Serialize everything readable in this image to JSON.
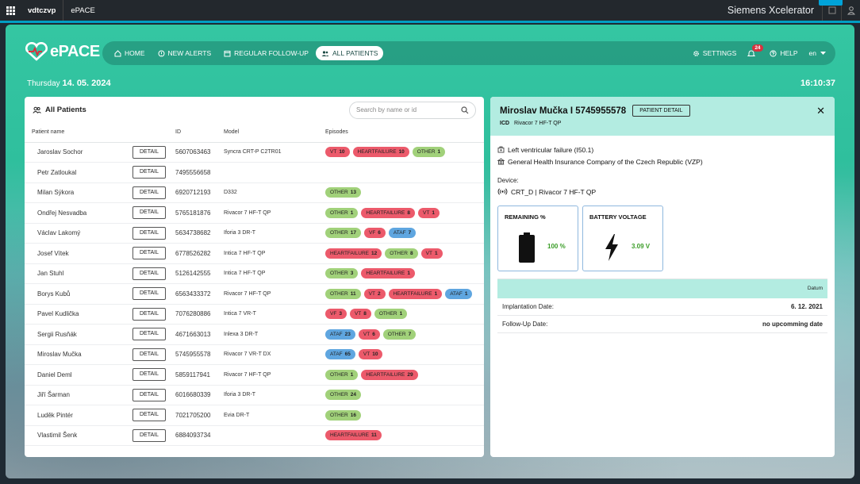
{
  "topbar": {
    "org": "vdtczvp",
    "app": "ePACE",
    "brand": "Siemens Xcelerator"
  },
  "header": {
    "logo_text": "ePACE",
    "nav": [
      {
        "label": "HOME",
        "icon": "home-icon"
      },
      {
        "label": "NEW ALERTS",
        "icon": "alert-icon"
      },
      {
        "label": "REGULAR FOLLOW-UP",
        "icon": "calendar-icon"
      },
      {
        "label": "ALL PATIENTS",
        "icon": "users-icon",
        "active": true
      }
    ],
    "settings_label": "SETTINGS",
    "notifications_count": "24",
    "help_label": "HELP",
    "language": "en"
  },
  "datebar": {
    "weekday": "Thursday",
    "date": "14. 05. 2024",
    "time": "16:10:37"
  },
  "patients_panel": {
    "title": "All Patients",
    "search_placeholder": "Search by name or id",
    "columns": [
      "Patient name",
      "ID",
      "Model",
      "Episodes"
    ],
    "detail_label": "DETAIL",
    "rows": [
      {
        "name": "Jaroslav Sochor",
        "id": "5607063463",
        "model": "Syncra CRT-P C2TR01",
        "episodes": [
          {
            "t": "VT",
            "n": "10",
            "c": "red"
          },
          {
            "t": "HEARTFAILURE",
            "n": "10",
            "c": "red"
          },
          {
            "t": "OTHER",
            "n": "1",
            "c": "green"
          }
        ]
      },
      {
        "name": "Petr Zatloukal",
        "id": "7495556658",
        "model": "",
        "episodes": []
      },
      {
        "name": "Milan Sýkora",
        "id": "6920712193",
        "model": "D332",
        "episodes": [
          {
            "t": "OTHER",
            "n": "13",
            "c": "green"
          }
        ]
      },
      {
        "name": "Ondřej Nesvadba",
        "id": "5765181876",
        "model": "Rivacor 7 HF-T QP",
        "episodes": [
          {
            "t": "OTHER",
            "n": "1",
            "c": "green"
          },
          {
            "t": "HEARTFAILURE",
            "n": "8",
            "c": "red"
          },
          {
            "t": "VT",
            "n": "1",
            "c": "red"
          }
        ]
      },
      {
        "name": "Václav Lakomý",
        "id": "5634738682",
        "model": "Iforia 3 DR-T",
        "episodes": [
          {
            "t": "OTHER",
            "n": "17",
            "c": "green"
          },
          {
            "t": "VF",
            "n": "6",
            "c": "red"
          },
          {
            "t": "ATAF",
            "n": "7",
            "c": "blue"
          }
        ]
      },
      {
        "name": "Josef Vítek",
        "id": "6778526282",
        "model": "Intica 7 HF-T QP",
        "episodes": [
          {
            "t": "HEARTFAILURE",
            "n": "12",
            "c": "red"
          },
          {
            "t": "OTHER",
            "n": "8",
            "c": "green"
          },
          {
            "t": "VT",
            "n": "1",
            "c": "red"
          }
        ]
      },
      {
        "name": "Jan Stuhl",
        "id": "5126142555",
        "model": "Intica 7 HF-T QP",
        "episodes": [
          {
            "t": "OTHER",
            "n": "3",
            "c": "green"
          },
          {
            "t": "HEARTFAILURE",
            "n": "1",
            "c": "red"
          }
        ]
      },
      {
        "name": "Borys Kubů",
        "id": "6563433372",
        "model": "Rivacor 7 HF-T QP",
        "episodes": [
          {
            "t": "OTHER",
            "n": "11",
            "c": "green"
          },
          {
            "t": "VT",
            "n": "2",
            "c": "red"
          },
          {
            "t": "HEARTFAILURE",
            "n": "1",
            "c": "red"
          },
          {
            "t": "ATAF",
            "n": "1",
            "c": "blue"
          }
        ]
      },
      {
        "name": "Pavel Kudlička",
        "id": "7076280886",
        "model": "Intica 7 VR-T",
        "episodes": [
          {
            "t": "VF",
            "n": "3",
            "c": "red"
          },
          {
            "t": "VT",
            "n": "8",
            "c": "red"
          },
          {
            "t": "OTHER",
            "n": "1",
            "c": "green"
          }
        ]
      },
      {
        "name": "Sergii Rusňák",
        "id": "4671663013",
        "model": "Inlexa 3 DR-T",
        "episodes": [
          {
            "t": "ATAF",
            "n": "23",
            "c": "blue"
          },
          {
            "t": "VT",
            "n": "6",
            "c": "red"
          },
          {
            "t": "OTHER",
            "n": "7",
            "c": "green"
          }
        ]
      },
      {
        "name": "Miroslav Mučka",
        "id": "5745955578",
        "model": "Rivacor 7 VR-T DX",
        "episodes": [
          {
            "t": "ATAF",
            "n": "65",
            "c": "blue"
          },
          {
            "t": "VT",
            "n": "10",
            "c": "red"
          }
        ]
      },
      {
        "name": "Daniel Deml",
        "id": "5859117941",
        "model": "Rivacor 7 HF-T QP",
        "episodes": [
          {
            "t": "OTHER",
            "n": "1",
            "c": "green"
          },
          {
            "t": "HEARTFAILURE",
            "n": "29",
            "c": "red"
          }
        ]
      },
      {
        "name": "Jiří Šarman",
        "id": "6016680339",
        "model": "Iforia 3 DR-T",
        "episodes": [
          {
            "t": "OTHER",
            "n": "24",
            "c": "green"
          }
        ]
      },
      {
        "name": "Luděk Pintér",
        "id": "7021705200",
        "model": "Evia DR-T",
        "episodes": [
          {
            "t": "OTHER",
            "n": "16",
            "c": "green"
          }
        ]
      },
      {
        "name": "Vlastimil Šenk",
        "id": "6884093734",
        "model": "",
        "episodes": [
          {
            "t": "HEARTFAILURE",
            "n": "11",
            "c": "red"
          }
        ]
      }
    ]
  },
  "patient_detail": {
    "title": "Miroslav Mučka I 5745955578",
    "detail_button": "PATIENT DETAIL",
    "device_type": "ICD",
    "device_model": "Rivacor 7 HF-T QP",
    "diagnosis": "Left ventricular failure (I50.1)",
    "insurance": "General Health Insurance Company of the Czech Republic (VZP)",
    "device_label": "Device:",
    "device_line": "CRT_D | Rivacor 7 HF-T QP",
    "remaining_title": "REMAINING %",
    "remaining_value": "100 %",
    "voltage_title": "BATTERY VOLTAGE",
    "voltage_value": "3.09 V",
    "dates_header": "Datum",
    "implantation_label": "Implantation Date:",
    "implantation_value": "6. 12. 2021",
    "followup_label": "Follow-Up Date:",
    "followup_value": "no upcomming date"
  },
  "colors": {
    "accent": "#34c6a2",
    "tag_red": "#ec5a6b",
    "tag_green": "#a1d17a",
    "tag_blue": "#5fa6e0"
  }
}
